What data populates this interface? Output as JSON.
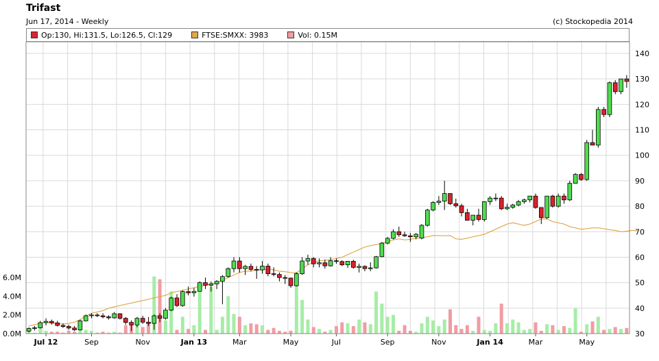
{
  "header": {
    "title": "Trifast",
    "subtitle": "Jun 17, 2014 - Weekly",
    "copyright": "(c) Stockopedia 2014"
  },
  "legend": [
    {
      "label": "Op:130, Hi:131.5, Lo:126.5, Cl:129",
      "color": "#d8242c"
    },
    {
      "label": "FTSE:SMXX: 3983",
      "color": "#e0a84a"
    },
    {
      "label": "Vol: 0.15M",
      "color": "#f19ca3"
    }
  ],
  "colors": {
    "up": "#4fdc4f",
    "down": "#d8242c",
    "index_line": "#e0a84a",
    "vol_up": "#a6eda6",
    "vol_down": "#f19ca3",
    "grid": "#d9d9d9"
  },
  "chart_data": {
    "type": "candlestick",
    "price_axis": {
      "ylim": [
        30,
        140
      ],
      "ticks": [
        "30",
        "40",
        "50",
        "60",
        "70",
        "80",
        "90",
        "100",
        "110",
        "120",
        "130",
        "140"
      ]
    },
    "volume_axis": {
      "ylim": [
        0,
        6.0
      ],
      "ticks": [
        "0.0M",
        "2.0M",
        "4.0M",
        "6.0M"
      ]
    },
    "x_ticks": [
      {
        "label": "Jul 12",
        "bold": true,
        "week": 3
      },
      {
        "label": "Sep",
        "bold": false,
        "week": 11
      },
      {
        "label": "Nov",
        "bold": false,
        "week": 20
      },
      {
        "label": "Jan 13",
        "bold": true,
        "week": 29
      },
      {
        "label": "Mar",
        "bold": false,
        "week": 37
      },
      {
        "label": "May",
        "bold": false,
        "week": 46
      },
      {
        "label": "Jul",
        "bold": false,
        "week": 54
      },
      {
        "label": "Sep",
        "bold": false,
        "week": 63
      },
      {
        "label": "Nov",
        "bold": false,
        "week": 72
      },
      {
        "label": "Jan 14",
        "bold": true,
        "week": 81
      },
      {
        "label": "Mar",
        "bold": false,
        "week": 89
      },
      {
        "label": "May",
        "bold": false,
        "week": 98
      }
    ],
    "ohlc": [
      [
        31,
        32.5,
        30.5,
        32
      ],
      [
        32,
        33,
        31.2,
        32.3
      ],
      [
        32.3,
        35,
        32,
        34.3
      ],
      [
        34.3,
        36,
        33.2,
        34.8
      ],
      [
        34.8,
        35.5,
        33.5,
        34.2
      ],
      [
        34.2,
        35,
        32.8,
        33.2
      ],
      [
        33.2,
        34,
        32.2,
        32.8
      ],
      [
        32.8,
        33.5,
        31.5,
        32.2
      ],
      [
        32.2,
        33,
        31,
        31.5
      ],
      [
        31.5,
        35.5,
        31.2,
        35
      ],
      [
        35,
        37.5,
        34.8,
        37
      ],
      [
        37,
        38,
        36,
        37.3
      ],
      [
        37.3,
        38,
        36.5,
        37
      ],
      [
        37,
        38,
        36,
        36.6
      ],
      [
        36.6,
        37.2,
        35.5,
        36.2
      ],
      [
        36.2,
        38.5,
        35.8,
        37.8
      ],
      [
        37.8,
        38,
        35.5,
        36
      ],
      [
        36,
        36.5,
        33.5,
        34.4
      ],
      [
        34.4,
        35.2,
        31,
        33.4
      ],
      [
        33.4,
        36.5,
        32.5,
        36
      ],
      [
        36,
        37,
        33.8,
        34.5
      ],
      [
        34.5,
        36.5,
        33,
        34
      ],
      [
        34,
        37.5,
        31.5,
        37
      ],
      [
        37,
        38,
        34.5,
        36
      ],
      [
        36,
        40,
        35.5,
        39.2
      ],
      [
        39.2,
        44.5,
        38.8,
        44
      ],
      [
        44,
        45.5,
        40.5,
        41
      ],
      [
        41,
        47,
        40.5,
        46.5
      ],
      [
        46.5,
        48.5,
        45,
        46
      ],
      [
        46,
        48,
        44.5,
        46.6
      ],
      [
        46.6,
        50.5,
        46.5,
        50
      ],
      [
        50,
        52,
        47.5,
        49
      ],
      [
        49,
        50.5,
        46.5,
        49.5
      ],
      [
        49.5,
        51,
        47.5,
        50.5
      ],
      [
        50.5,
        53,
        41.5,
        52.4
      ],
      [
        52.4,
        56,
        52,
        55.5
      ],
      [
        55.5,
        60,
        54,
        58.5
      ],
      [
        58.5,
        60,
        54,
        55.5
      ],
      [
        55.5,
        57,
        53,
        56.4
      ],
      [
        56.4,
        57.5,
        54.5,
        55.2
      ],
      [
        55.2,
        56.5,
        51.5,
        55
      ],
      [
        55,
        58.5,
        53.5,
        56.5
      ],
      [
        56.5,
        57.5,
        52.5,
        53.5
      ],
      [
        53.5,
        56,
        52.5,
        53.2
      ],
      [
        53.2,
        54,
        50.5,
        52
      ],
      [
        52,
        53,
        49.5,
        51.8
      ],
      [
        51.8,
        52,
        48,
        48.8
      ],
      [
        48.8,
        54,
        48.5,
        53.5
      ],
      [
        53.5,
        60,
        53,
        58.5
      ],
      [
        58.5,
        61,
        57,
        59.5
      ],
      [
        59.5,
        60,
        56,
        57.4
      ],
      [
        57.4,
        59.5,
        56,
        57.8
      ],
      [
        57.8,
        59,
        55.5,
        56.6
      ],
      [
        56.6,
        60,
        56.3,
        58.6
      ],
      [
        58.6,
        59.5,
        57.4,
        58.3
      ],
      [
        58.3,
        58.8,
        56.5,
        57
      ],
      [
        57,
        58.5,
        55.8,
        58.4
      ],
      [
        58.4,
        59,
        55.5,
        56
      ],
      [
        56,
        57.5,
        54,
        56.4
      ],
      [
        56.4,
        56.8,
        54.5,
        55.5
      ],
      [
        55.5,
        58,
        54.5,
        55.8
      ],
      [
        55.8,
        60.5,
        55.5,
        60.2
      ],
      [
        60.2,
        66,
        60,
        65.5
      ],
      [
        65.5,
        68,
        65,
        67.4
      ],
      [
        67.4,
        71,
        67,
        70
      ],
      [
        70,
        72,
        68,
        68.8
      ],
      [
        68.8,
        70,
        68,
        68.4
      ],
      [
        68.4,
        69.5,
        66,
        68
      ],
      [
        68,
        69.5,
        67,
        69
      ],
      [
        67.5,
        73,
        67,
        72.5
      ],
      [
        72.5,
        79,
        72,
        78.5
      ],
      [
        78.5,
        82,
        78,
        81.5
      ],
      [
        81.5,
        84,
        80.5,
        82
      ],
      [
        82,
        90,
        78.5,
        85
      ],
      [
        85,
        85,
        80.5,
        81
      ],
      [
        81,
        83,
        79.5,
        80.2
      ],
      [
        80.2,
        81,
        76,
        77.5
      ],
      [
        77.5,
        79,
        75,
        74.5
      ],
      [
        74.5,
        76,
        72.5,
        76.5
      ],
      [
        76.5,
        79,
        74,
        74.8
      ],
      [
        74.8,
        82,
        74,
        81.8
      ],
      [
        81.8,
        84,
        80.5,
        83.2
      ],
      [
        83.2,
        85,
        82,
        83.2
      ],
      [
        83.2,
        84,
        78.5,
        79
      ],
      [
        79,
        81,
        78.5,
        79.6
      ],
      [
        79.6,
        81,
        79,
        80.5
      ],
      [
        80.5,
        82.5,
        80,
        81.8
      ],
      [
        81.8,
        83,
        81,
        82.5
      ],
      [
        82.5,
        84,
        81.5,
        84
      ],
      [
        84,
        85,
        79,
        79.5
      ],
      [
        79.5,
        79.5,
        73,
        75.5
      ],
      [
        75.5,
        84,
        75,
        84
      ],
      [
        84,
        84.5,
        79.5,
        80
      ],
      [
        80,
        85,
        79.5,
        84
      ],
      [
        84,
        85,
        81,
        82.5
      ],
      [
        82.5,
        90,
        82,
        89
      ],
      [
        89,
        93,
        89,
        92.5
      ],
      [
        92.5,
        93,
        90,
        90.5
      ],
      [
        90.5,
        106,
        90,
        105
      ],
      [
        105,
        110,
        104,
        104
      ],
      [
        104,
        119,
        103,
        118
      ],
      [
        118,
        119,
        115,
        116
      ],
      [
        116,
        129,
        115,
        128.5
      ],
      [
        128.5,
        129.5,
        124,
        125
      ],
      [
        125,
        130,
        124,
        130
      ],
      [
        130,
        131.5,
        126.5,
        129
      ]
    ],
    "volume": [
      0.3,
      0.1,
      1.2,
      0.3,
      0.2,
      0.2,
      0.1,
      0.3,
      0.2,
      0.9,
      0.4,
      0.3,
      0.1,
      0.2,
      0.1,
      0.2,
      0.1,
      0.9,
      1.0,
      1.1,
      0.7,
      1.1,
      6.1,
      5.8,
      1.4,
      4.5,
      0.4,
      1.8,
      0.5,
      0.9,
      5.2,
      0.4,
      5.0,
      0.4,
      1.8,
      4.0,
      2.1,
      1.8,
      0.9,
      1.1,
      1.0,
      0.9,
      0.4,
      0.6,
      0.3,
      0.2,
      0.3,
      6.6,
      3.6,
      1.5,
      0.7,
      0.5,
      0.2,
      0.4,
      0.8,
      1.2,
      1.1,
      0.8,
      1.5,
      1.2,
      1.0,
      4.5,
      3.2,
      1.8,
      2.0,
      0.3,
      0.9,
      0.3,
      0.2,
      1.1,
      1.8,
      1.4,
      0.8,
      1.5,
      2.6,
      0.9,
      0.5,
      0.9,
      0.3,
      1.8,
      0.4,
      0.3,
      1.1,
      3.2,
      1.1,
      1.5,
      1.2,
      0.4,
      0.5,
      1.2,
      0.3,
      1.0,
      0.9,
      0.4,
      0.8,
      0.6,
      2.7,
      0.2,
      1.0,
      1.3,
      1.8,
      0.4,
      0.5,
      0.7,
      0.5,
      0.6
    ],
    "ftse_index": [
      33,
      33.5,
      34,
      34.5,
      34.2,
      34,
      33.8,
      34,
      34.5,
      35.5,
      37,
      38,
      38.5,
      39,
      40,
      40.5,
      41,
      41.5,
      42,
      42.5,
      43,
      43.5,
      44,
      44.5,
      45,
      46,
      46.5,
      47,
      47.5,
      48,
      48.5,
      49,
      49.5,
      50,
      51,
      52,
      53,
      54,
      54.5,
      54.5,
      55,
      55,
      55.5,
      55,
      54.5,
      54.3,
      54,
      53.8,
      55.5,
      57,
      58,
      58.5,
      58.8,
      59,
      59.5,
      60,
      61,
      62,
      63,
      64,
      64.5,
      65,
      65.5,
      66,
      66.8,
      67.2,
      66.8,
      67,
      67.4,
      67.6,
      68,
      68.5,
      68.5,
      68.4,
      68.5,
      67.2,
      67,
      67.5,
      68,
      68.5,
      69,
      70,
      71,
      72,
      73,
      73.5,
      73,
      72.5,
      73,
      74,
      75,
      75,
      74,
      73.5,
      73,
      72,
      71.5,
      71,
      71.2,
      71.5,
      71.5,
      71.2,
      70.8,
      70.5,
      70,
      70.2,
      70.5,
      70.3
    ]
  }
}
